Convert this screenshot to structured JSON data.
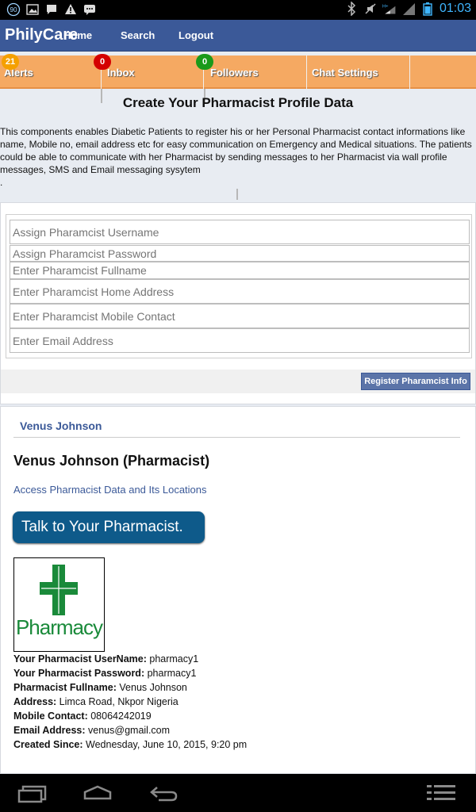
{
  "status_bar": {
    "time": "01:03",
    "notif_count": "90",
    "icons": [
      "notification-count-icon",
      "image-icon",
      "chat-icon",
      "warning-icon",
      "bbm-icon",
      "bluetooth-icon",
      "mute-icon",
      "signal-h-plus-icon",
      "signal-icon",
      "battery-icon"
    ]
  },
  "header": {
    "brand": "PhilyCare",
    "nav": [
      "Home",
      "Search",
      "Logout"
    ]
  },
  "tabs": [
    {
      "label": "Alerts",
      "badge": "21",
      "badge_color": "#f5a000"
    },
    {
      "label": "Inbox",
      "badge": "0",
      "badge_color": "#d40000"
    },
    {
      "label": "Followers",
      "badge": "0",
      "badge_color": "#1a9a1a"
    },
    {
      "label": "Chat Settings"
    }
  ],
  "page": {
    "title": "Create Your Pharmacist Profile Data",
    "description": "This components enables Diabetic Patients to register his or her Personal Pharmacist contact informations like name, Mobile no, email address etc for easy communication on Emergency and Medical situations. The patients could be able to communicate with her Pharmacist by sending messages to her Pharmacist via wall profile messages, SMS and Email messaging sysytem",
    "dot": "."
  },
  "form": {
    "fields": [
      {
        "placeholder": "Assign Pharamcist Username"
      },
      {
        "placeholder": "Assign Pharamcist Password"
      },
      {
        "placeholder": "Enter Pharamcist Fullname"
      },
      {
        "placeholder": "Enter Pharamcist Home Address"
      },
      {
        "placeholder": "Enter Pharamcist Mobile Contact"
      },
      {
        "placeholder": "Enter Email Address"
      }
    ],
    "submit_label": "Register Pharamcist Info"
  },
  "profile": {
    "name_link": "Venus Johnson",
    "heading": "Venus Johnson (Pharmacist)",
    "access_link": "Access Pharmacist Data and Its Locations",
    "talk_button": "Talk to Your Pharmacist.",
    "logo_text": "Pharmacy",
    "details": [
      {
        "label": "Your Pharmacist UserName:",
        "value": "pharmacy1"
      },
      {
        "label": "Your Pharmacist Password:",
        "value": "pharmacy1"
      },
      {
        "label": "Pharmacist Fullname:",
        "value": "Venus Johnson"
      },
      {
        "label": "Address:",
        "value": "Limca Road, Nkpor Nigeria"
      },
      {
        "label": "Mobile Contact:",
        "value": "08064242019"
      },
      {
        "label": "Email Address:",
        "value": "venus@gmail.com"
      },
      {
        "label": "Created Since:",
        "value": "Wednesday, June 10, 2015, 9:20 pm"
      }
    ]
  },
  "nav_bar": {
    "icons": [
      "recent-apps-icon",
      "home-icon",
      "back-icon",
      "menu-icon"
    ]
  },
  "colors": {
    "header_blue": "#3b5998",
    "tab_orange": "#f5a962",
    "button_blue": "#0e5a8a",
    "pharmacy_green": "#1a8a3a"
  }
}
